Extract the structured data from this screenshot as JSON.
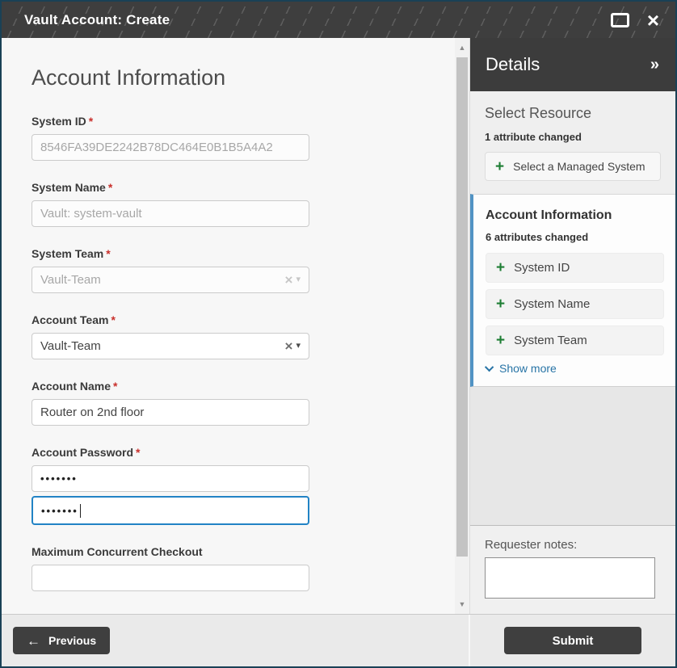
{
  "window": {
    "title": "Vault Account: Create"
  },
  "icons": {
    "maximize": "rect-outline",
    "close": "×",
    "collapse_panel": "»",
    "clear_selection": "×",
    "dropdown_caret": "▾",
    "add_plus": "+",
    "previous_arrow": "←",
    "scrollbar_up": "▲",
    "scrollbar_down": "▼"
  },
  "form": {
    "heading": "Account Information",
    "required_marker": "*",
    "system_id": {
      "label": "System ID",
      "value": "8546FA39DE2242B78DC464E0B1B5A4A2"
    },
    "system_name": {
      "label": "System Name",
      "value": "Vault: system-vault"
    },
    "system_team": {
      "label": "System Team",
      "value": "Vault-Team"
    },
    "account_team": {
      "label": "Account Team",
      "value": "Vault-Team"
    },
    "account_name": {
      "label": "Account Name",
      "value": "Router on 2nd floor"
    },
    "account_password": {
      "label": "Account Password",
      "masked_value": "•••••••",
      "confirm_masked_value": "•••••••"
    },
    "max_concurrent_checkout": {
      "label": "Maximum Concurrent Checkout",
      "value": ""
    }
  },
  "details_panel": {
    "header": "Details",
    "select_resource": {
      "heading": "Select Resource",
      "status": "1 attribute changed",
      "action_label": "Select a Managed System"
    },
    "account_information": {
      "heading": "Account Information",
      "status": "6 attributes changed",
      "attributes": [
        "System ID",
        "System Name",
        "System Team"
      ],
      "show_more_label": "Show more"
    },
    "requester_notes_label": "Requester notes:"
  },
  "footer": {
    "previous_label": "Previous",
    "submit_label": "Submit"
  },
  "colors": {
    "titlebar_bg": "#3e3e3e",
    "window_border": "#1a4156",
    "focus_blue": "#2283c5",
    "card_accent_blue": "#5193c4",
    "plus_green": "#1e7e34",
    "link_blue": "#2874a6",
    "required_red": "#c9302c"
  }
}
